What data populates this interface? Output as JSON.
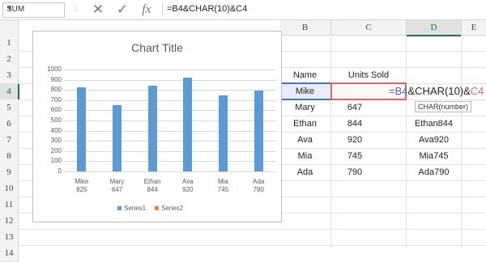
{
  "formula_bar": {
    "name_box": "SUM",
    "formula": "=B4&CHAR(10)&C4",
    "cancel_icon": "cancel-icon",
    "enter_icon": "check-icon",
    "fx_label": "fx"
  },
  "columns": [
    "B",
    "C",
    "D",
    "E"
  ],
  "rows": [
    "1",
    "2",
    "3",
    "4",
    "5",
    "6",
    "7",
    "8",
    "9",
    "10",
    "11",
    "12",
    "13",
    "14"
  ],
  "table": {
    "headers": [
      "Name",
      "Units Sold"
    ],
    "rows": [
      {
        "name": "Mike",
        "units": "",
        "result": ""
      },
      {
        "name": "Mary",
        "units": "647",
        "result": ""
      },
      {
        "name": "Ethan",
        "units": "844",
        "result": "Ethan844"
      },
      {
        "name": "Ava",
        "units": "920",
        "result": "Ava920"
      },
      {
        "name": "Mia",
        "units": "745",
        "result": "Mia745"
      },
      {
        "name": "Ada",
        "units": "790",
        "result": "Ada790"
      }
    ]
  },
  "editor": {
    "ref1": "=B4",
    "op1": "&CHAR(10)&",
    "ref2": "C4",
    "tooltip": "CHAR(number)"
  },
  "colors": {
    "accent": "#217346",
    "bar": "#5b9bd5",
    "series2": "#ed7d31",
    "ref1": "#4472c4",
    "ref2": "#e06666"
  },
  "chart_data": {
    "type": "bar",
    "title": "Chart Title",
    "categories": [
      [
        "Mike",
        "825"
      ],
      [
        "Mary",
        "647"
      ],
      [
        "Ethan",
        "844"
      ],
      [
        "Ava",
        "920"
      ],
      [
        "Mia",
        "745"
      ],
      [
        "Ada",
        "790"
      ]
    ],
    "series": [
      {
        "name": "Series1",
        "values": [
          825,
          647,
          844,
          920,
          745,
          790
        ]
      },
      {
        "name": "Series2",
        "values": []
      }
    ],
    "ylim": [
      0,
      1000
    ],
    "yticks": [
      "0",
      "100",
      "200",
      "300",
      "400",
      "500",
      "600",
      "700",
      "800",
      "900",
      "1000"
    ],
    "grid": true,
    "legend": "bottom"
  }
}
